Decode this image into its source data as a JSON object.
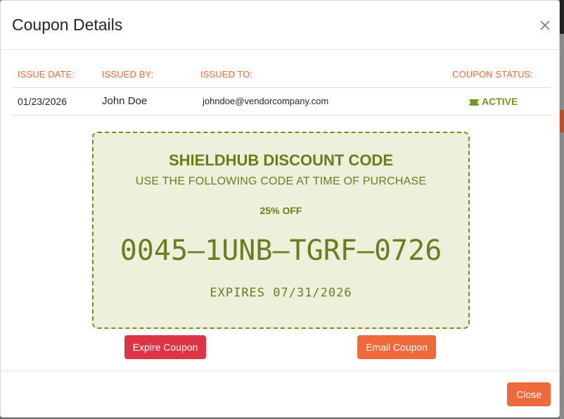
{
  "modal": {
    "title": "Coupon Details",
    "close_icon": "close-icon"
  },
  "info": {
    "headers": [
      "ISSUE DATE:",
      "ISSUED BY:",
      "ISSUED TO:",
      "COUPON STATUS:"
    ],
    "issue_date": "01/23/2026",
    "issued_by": "John Doe",
    "issued_to": "johndoe@vendorcompany.com",
    "status": "ACTIVE",
    "status_icon": "ticket-icon",
    "status_color": "#6e9a1f"
  },
  "coupon": {
    "brand": "SHIELDHUB DISCOUNT CODE",
    "instruction": "USE THE FOLLOWING CODE AT TIME OF PURCHASE",
    "discount": "25% OFF",
    "code": "0045–1UNB–TGRF–0726",
    "expires": "EXPIRES 07/31/2026",
    "accent_color": "#6d7a1e",
    "background_color": "#eef0dc"
  },
  "actions": {
    "expire_label": "Expire Coupon",
    "email_label": "Email Coupon",
    "close_label": "Close"
  },
  "colors": {
    "primary_orange": "#ee6a3a",
    "danger_red": "#dc3545"
  }
}
